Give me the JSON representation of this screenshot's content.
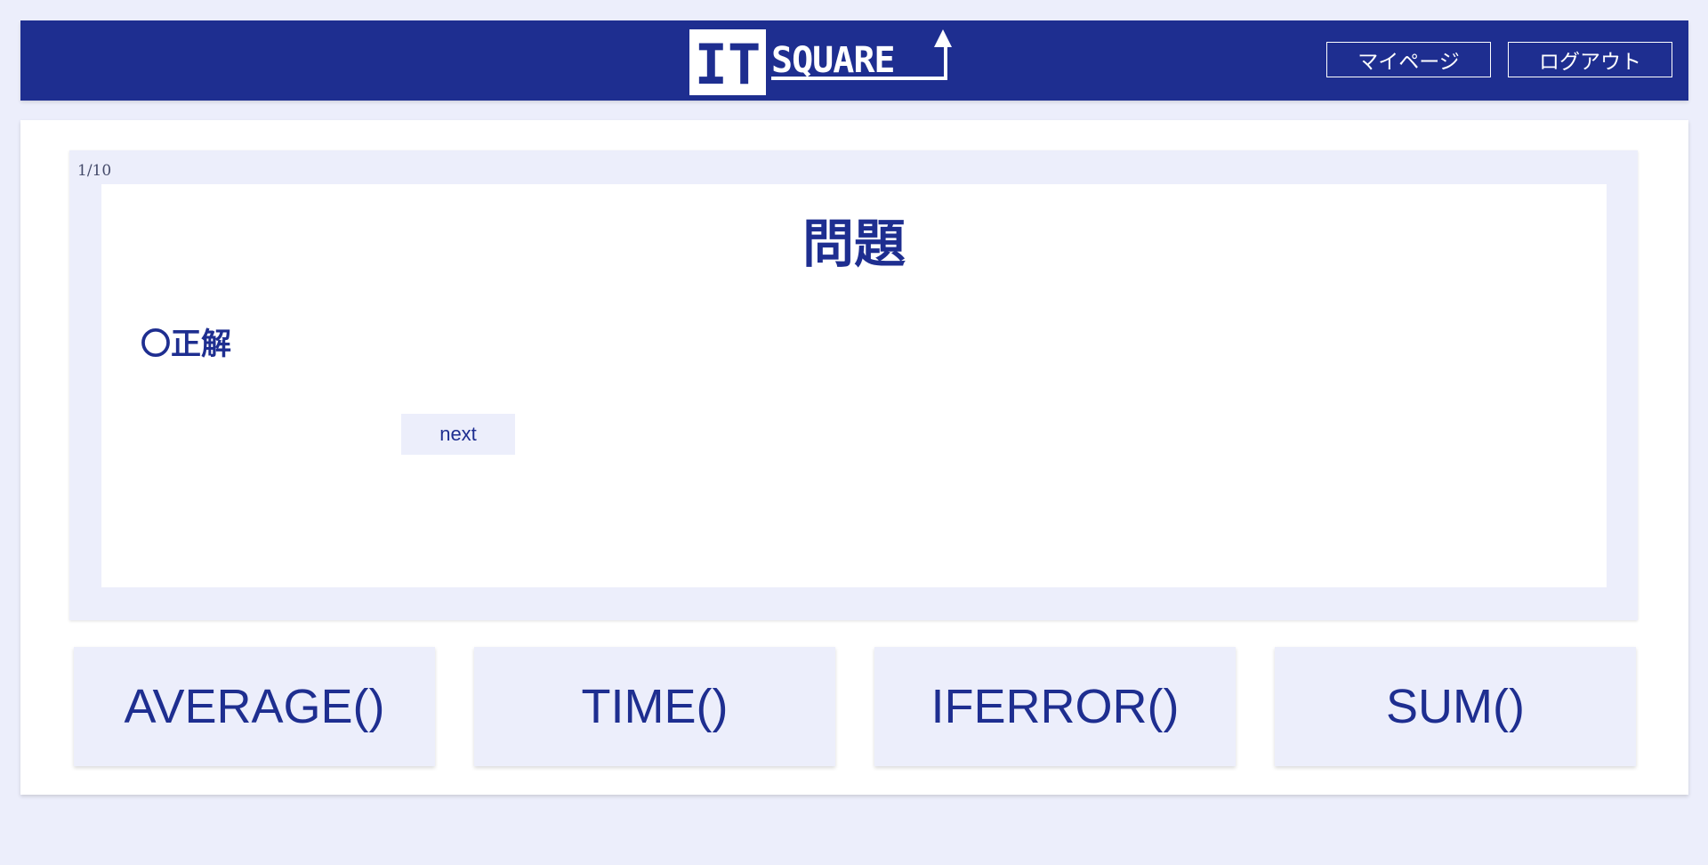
{
  "header": {
    "logo_text_left": "IT",
    "logo_text_right": "SQUARE",
    "mypage_label": "マイページ",
    "logout_label": "ログアウト"
  },
  "question": {
    "counter": "1/10",
    "title": "問題",
    "result": "〇正解",
    "next_label": "next"
  },
  "choices": [
    {
      "label": "AVERAGE()"
    },
    {
      "label": "TIME()"
    },
    {
      "label": "IFERROR()"
    },
    {
      "label": "SUM()"
    }
  ],
  "colors": {
    "brand": "#1e2e90",
    "background": "#eceefb",
    "panel": "#ffffff"
  }
}
